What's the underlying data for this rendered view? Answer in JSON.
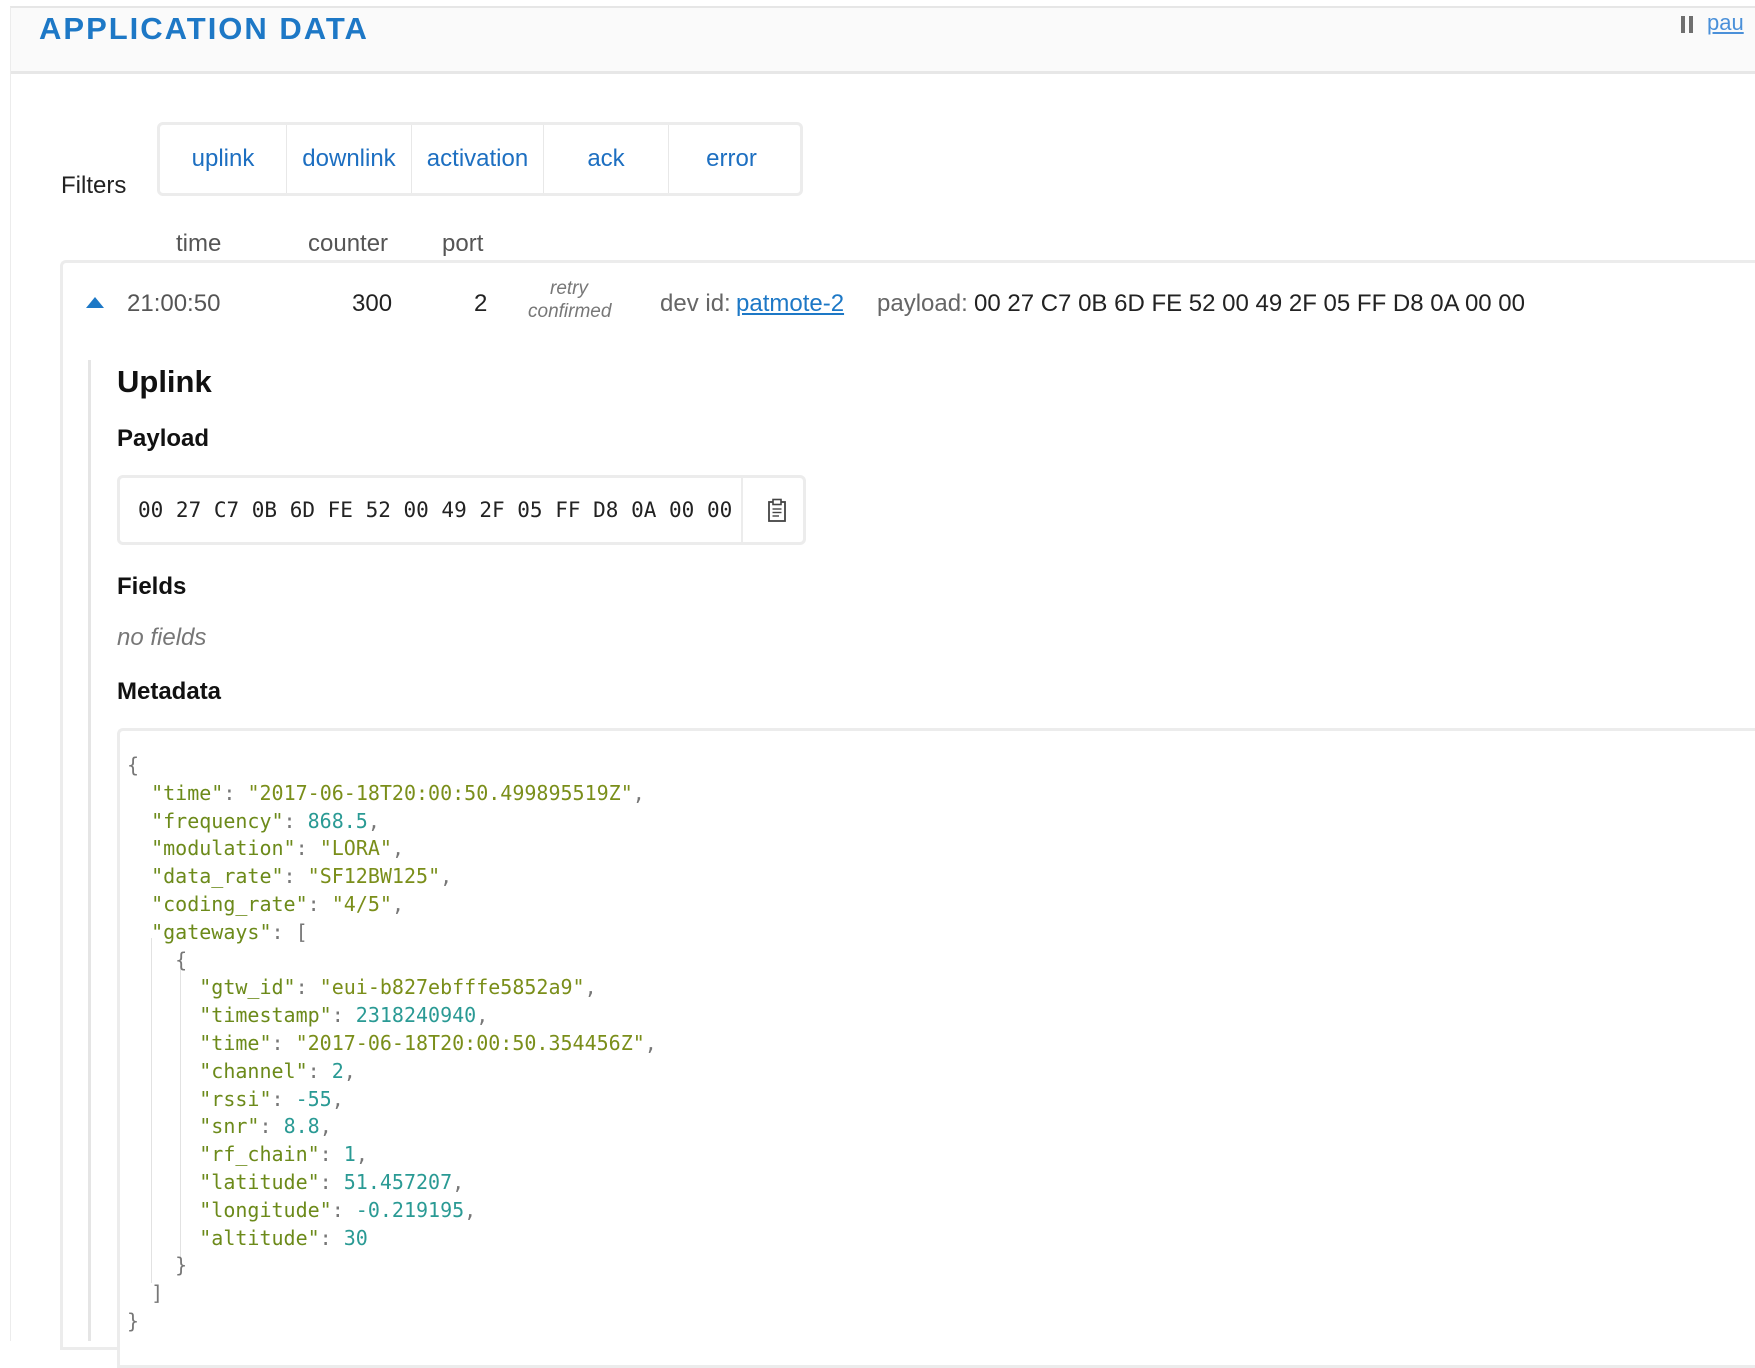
{
  "header": {
    "title": "APPLICATION DATA",
    "pause_label": "pau"
  },
  "filters": {
    "label": "Filters",
    "buttons": [
      {
        "label": "uplink"
      },
      {
        "label": "downlink"
      },
      {
        "label": "activation"
      },
      {
        "label": "ack"
      },
      {
        "label": "error"
      }
    ]
  },
  "columns": {
    "time": "time",
    "counter": "counter",
    "port": "port"
  },
  "message": {
    "time": "21:00:50",
    "counter": "300",
    "port": "2",
    "flag_retry": "retry",
    "flag_confirmed": "confirmed",
    "dev_id_label": "dev id:",
    "dev_id": "patmote-2",
    "payload_label": "payload:",
    "payload": "00 27 C7 0B 6D FE 52 00 49 2F 05 FF D8 0A 00 00"
  },
  "detail": {
    "type_title": "Uplink",
    "payload_title": "Payload",
    "payload_hex": "00 27 C7 0B 6D FE 52 00 49 2F 05 FF D8 0A 00 00",
    "fields_title": "Fields",
    "fields_empty": "no fields",
    "metadata_title": "Metadata"
  },
  "metadata": {
    "time": "2017-06-18T20:00:50.499895519Z",
    "frequency": "868.5",
    "modulation": "LORA",
    "data_rate": "SF12BW125",
    "coding_rate": "4/5",
    "gateway": {
      "gtw_id": "eui-b827ebfffe5852a9",
      "timestamp": "2318240940",
      "time": "2017-06-18T20:00:50.354456Z",
      "channel": "2",
      "rssi": "-55",
      "snr": "8.8",
      "rf_chain": "1",
      "latitude": "51.457207",
      "longitude": "-0.219195",
      "altitude": "30"
    }
  },
  "icons": {
    "pause": "pause-icon",
    "collapse": "triangle-up-icon",
    "copy": "clipboard-icon"
  },
  "colors": {
    "accent": "#1d78c6",
    "json_key": "#6c8a1a",
    "json_number": "#2a9a94"
  }
}
